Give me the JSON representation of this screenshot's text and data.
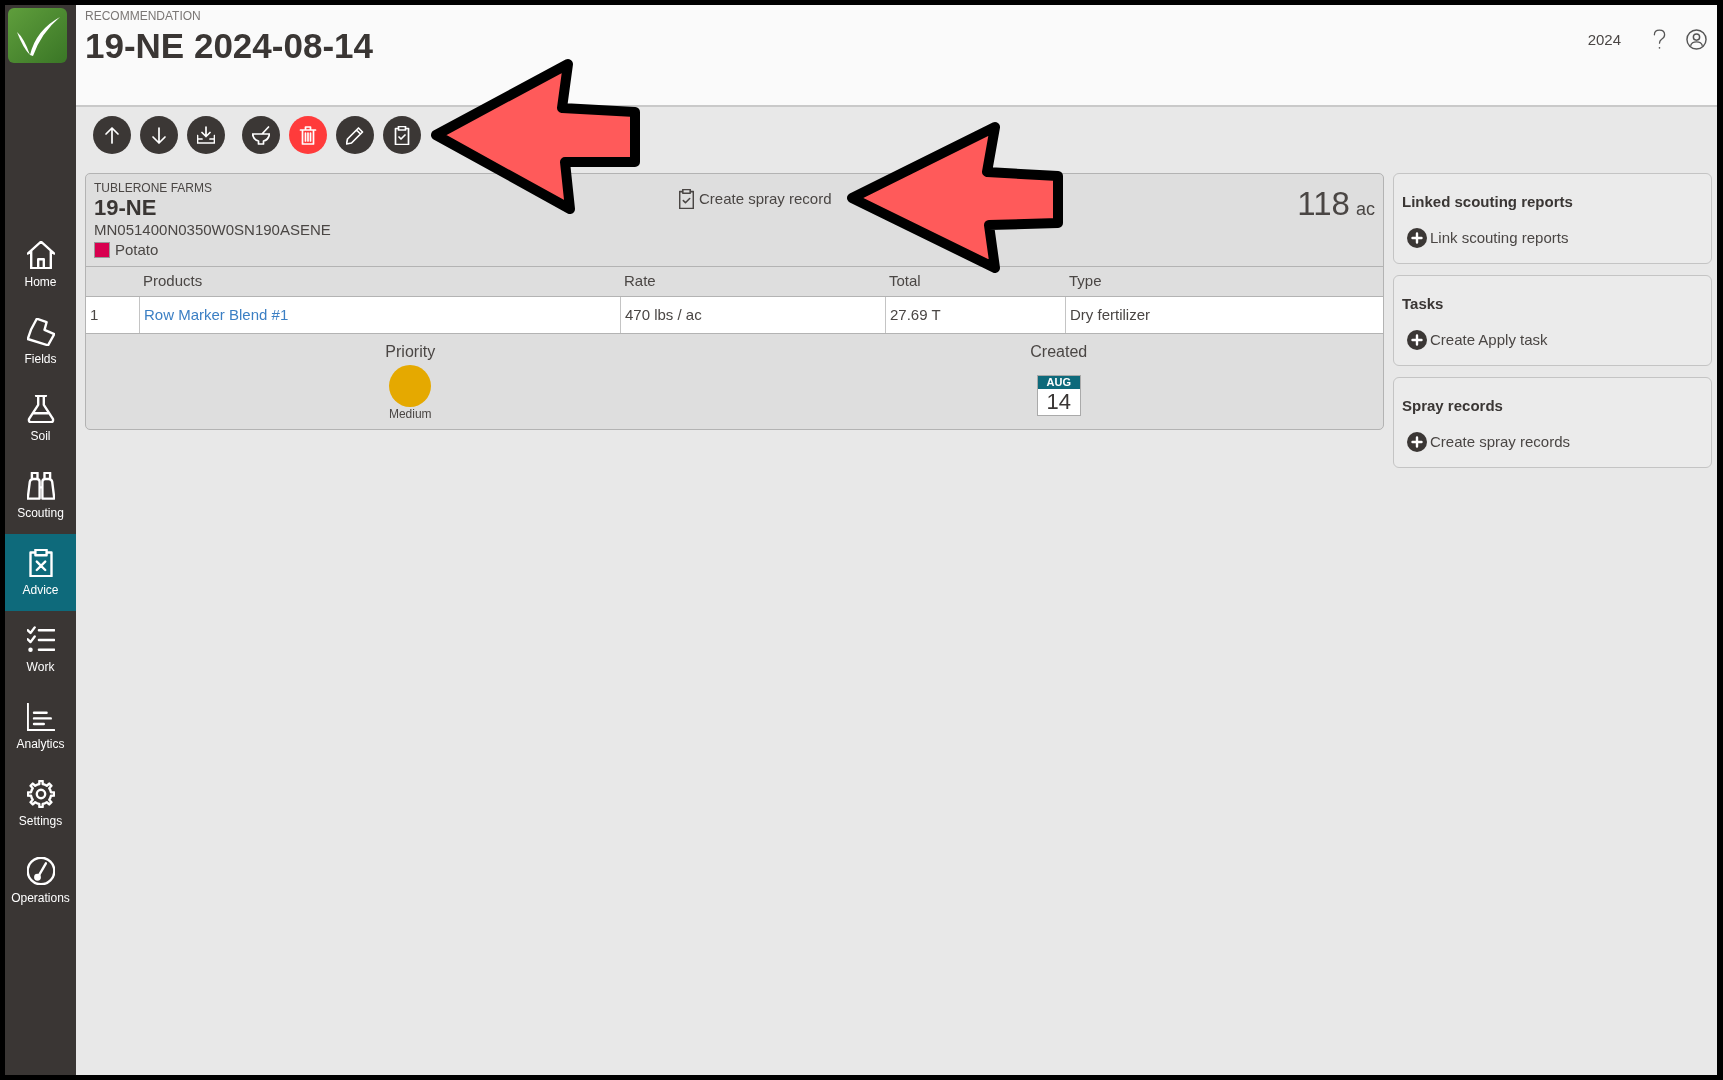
{
  "sidebar": {
    "items": [
      {
        "label": "Home",
        "selected": false
      },
      {
        "label": "Fields",
        "selected": false
      },
      {
        "label": "Soil",
        "selected": false
      },
      {
        "label": "Scouting",
        "selected": false
      },
      {
        "label": "Advice",
        "selected": true
      },
      {
        "label": "Work",
        "selected": false
      },
      {
        "label": "Analytics",
        "selected": false
      },
      {
        "label": "Settings",
        "selected": false
      },
      {
        "label": "Operations",
        "selected": false
      }
    ]
  },
  "header": {
    "section": "RECOMMENDATION",
    "title": "19-NE 2024-08-14",
    "year": "2024"
  },
  "recommendation": {
    "farm": "TUBLERONE FARMS",
    "field": "19-NE",
    "legal_description": "MN051400N0350W0SN190ASENE",
    "crop": {
      "name": "Potato",
      "color": "#d8004f"
    },
    "action": "Create spray record",
    "area": {
      "value": "118",
      "unit": "ac"
    },
    "table": {
      "columns": [
        "",
        "Products",
        "Rate",
        "Total",
        "Type"
      ],
      "rows": [
        {
          "cells": [
            "1",
            "Row Marker Blend #1",
            "470 lbs / ac",
            "27.69 T",
            "Dry fertilizer"
          ]
        }
      ]
    },
    "priority": {
      "label": "Priority",
      "value": "Medium",
      "color": "#e5a900"
    },
    "created": {
      "label": "Created",
      "month": "AUG",
      "day": "14"
    }
  },
  "panels": [
    {
      "title": "Linked scouting reports",
      "action": "Link scouting reports"
    },
    {
      "title": "Tasks",
      "action": "Create Apply task"
    },
    {
      "title": "Spray records",
      "action": "Create spray records"
    }
  ]
}
